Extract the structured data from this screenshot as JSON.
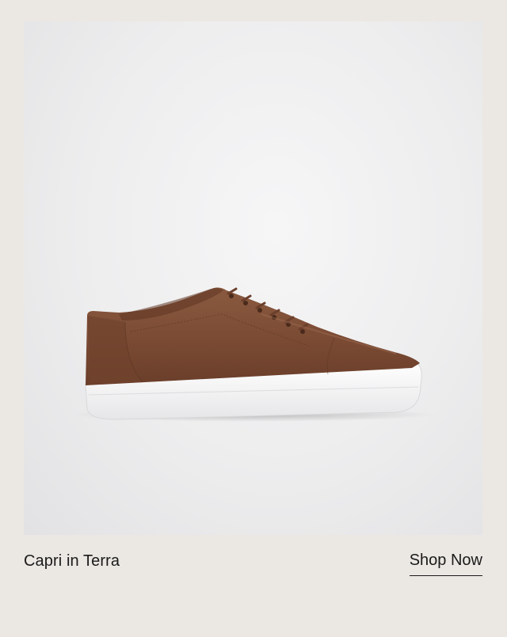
{
  "product": {
    "image_subject": "sneaker-icon",
    "name": "Capri in Terra"
  },
  "cta": {
    "label": "Shop Now"
  },
  "colors": {
    "page_background": "#ebe8e4",
    "image_background": "#ededee",
    "leather": "#7a4a33",
    "sole": "#ffffff",
    "text": "#1a1a1a"
  }
}
